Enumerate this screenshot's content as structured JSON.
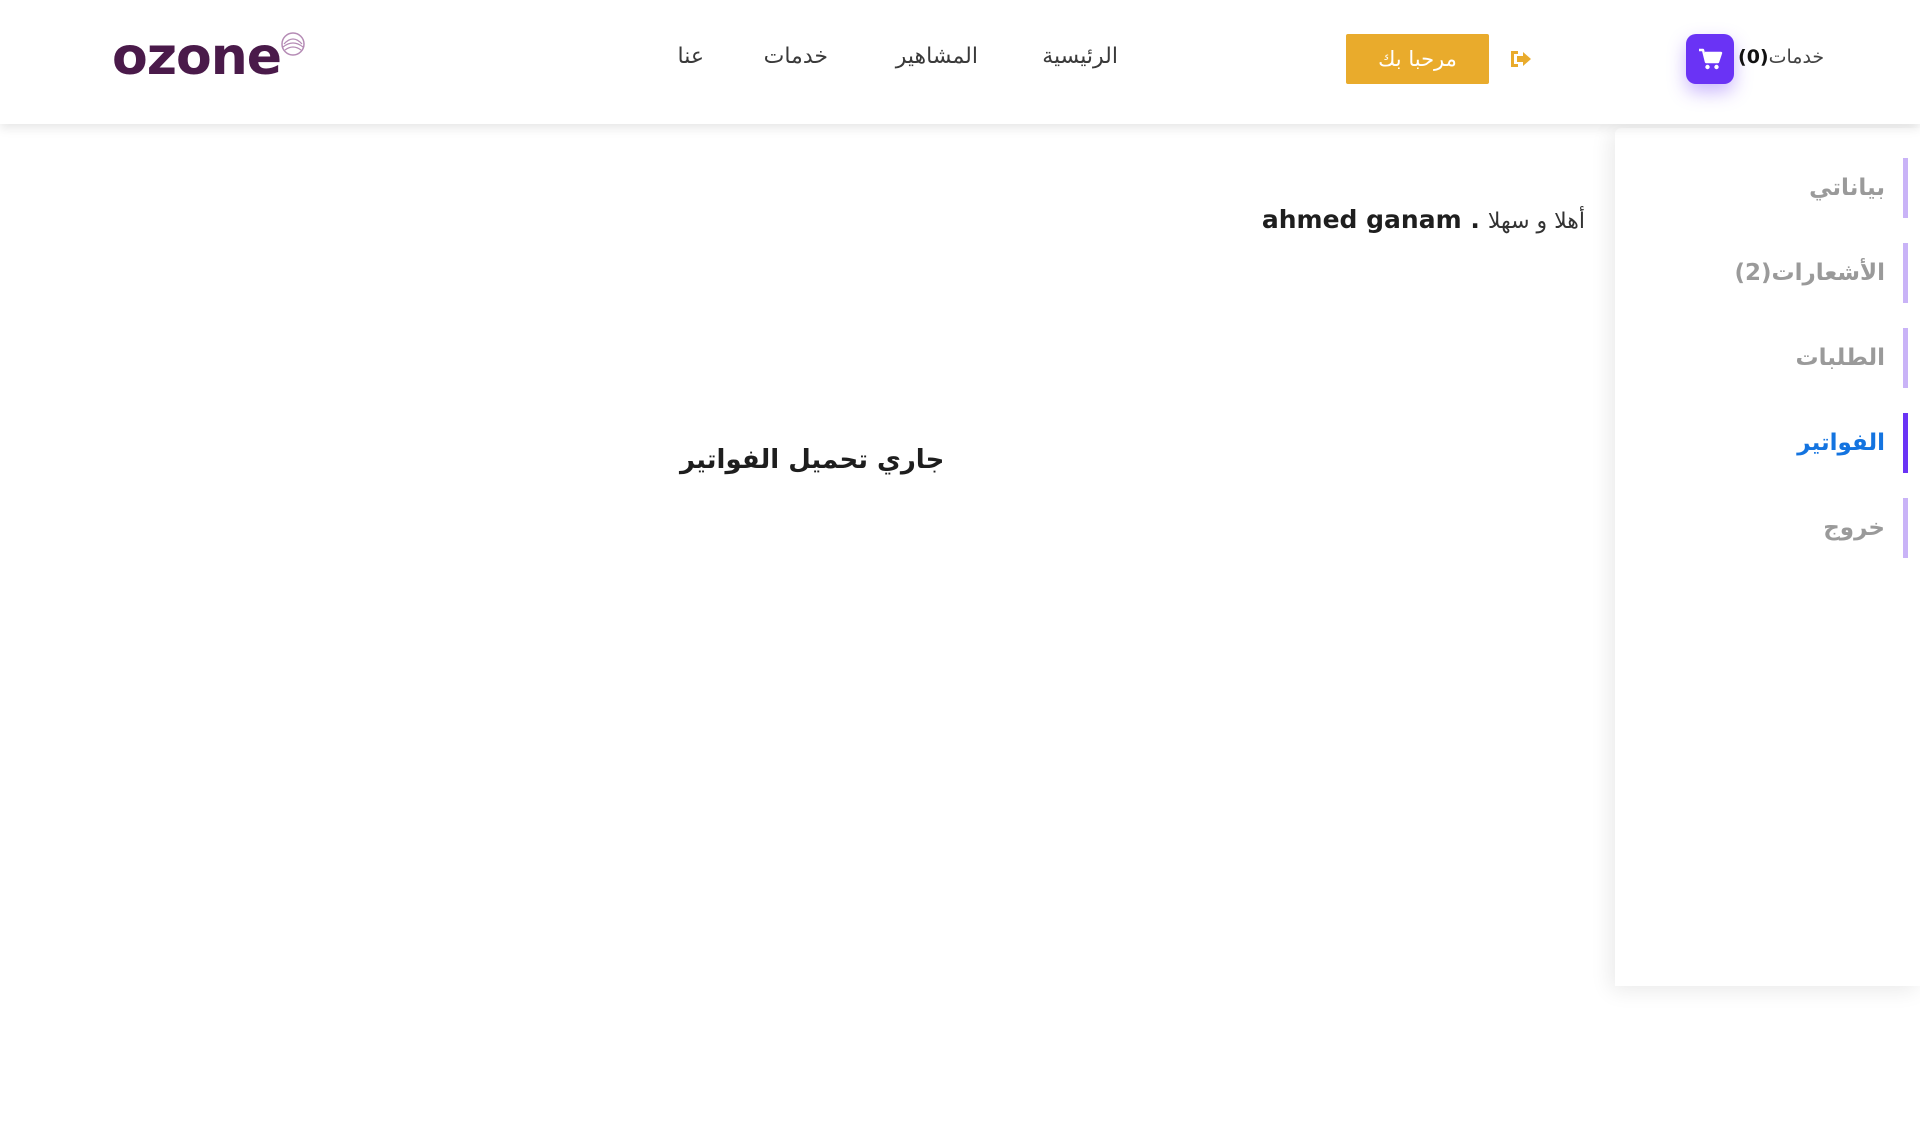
{
  "brand": {
    "logo_text": "ozone",
    "color": "#4a1a4a"
  },
  "nav": {
    "home": "الرئيسية",
    "celebrities": "المشاهير",
    "services": "خدمات",
    "about": "عنا"
  },
  "header": {
    "welcome_button": "مرحبا بك",
    "logout_icon": "sign-out-icon",
    "cart_icon": "shopping-cart-icon",
    "cart_label": "خدمات",
    "cart_count": "(0)"
  },
  "sidebar": {
    "items": [
      {
        "label": "بياناتي",
        "active": false
      },
      {
        "label": "الأشعارات(2)",
        "active": false
      },
      {
        "label": "الطلبات",
        "active": false
      },
      {
        "label": "الفواتير",
        "active": true
      },
      {
        "label": "خروج",
        "active": false
      }
    ]
  },
  "main": {
    "greeting_prefix": "أهلا و سهلا",
    "user_name": "ahmed ganam .",
    "loading_message": "جاري تحميل الفواتير"
  },
  "colors": {
    "accent_purple": "#6a33f5",
    "button_yellow": "#e9ab2c",
    "active_blue": "#1474e0",
    "inactive_gray": "#9a9a9a"
  }
}
